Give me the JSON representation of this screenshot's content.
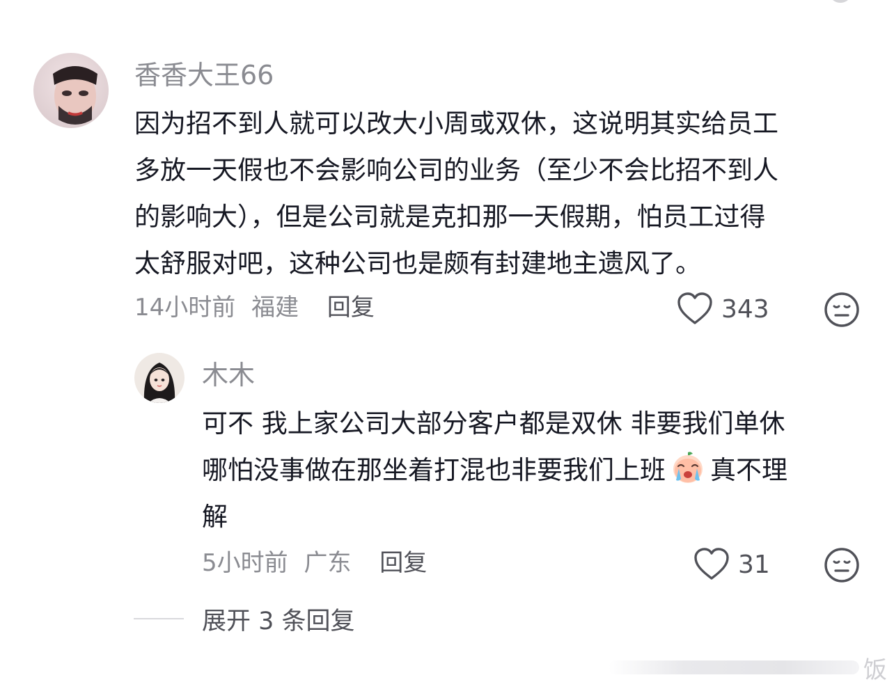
{
  "comments": [
    {
      "username": "香香大王66",
      "lines": [
        "因为招不到人就可以改大小周或双休，这说明其实给员工",
        "多放一天假也不会影响公司的业务（至少不会比招不到人",
        "的影响大），但是公司就是克扣那一天假期，怕员工过得",
        "太舒服对吧，这种公司也是颇有封建地主遗风了。"
      ],
      "time": "14小时前",
      "location": "福建",
      "reply_label": "回复",
      "likes": "343",
      "icons": {
        "like": "heart-outline-icon",
        "dislike": "meh-face-icon"
      }
    },
    {
      "username": "木木",
      "lines": [
        "可不 我上家公司大部分客户都是双休 非要我们单休",
        "哪怕没事做在那坐着打混也非要我们上班",
        "解"
      ],
      "line2_after_emoji": "真不理",
      "emoji": "crying-peach-emoji",
      "time": "5小时前",
      "location": "广东",
      "reply_label": "回复",
      "likes": "31",
      "icons": {
        "like": "heart-outline-icon",
        "dislike": "meh-face-icon"
      }
    }
  ],
  "expand_replies": "展开 3 条回复",
  "watermark": "饭",
  "colors": {
    "text": "#161823",
    "muted": "#8a8b91",
    "reply": "#505158"
  }
}
